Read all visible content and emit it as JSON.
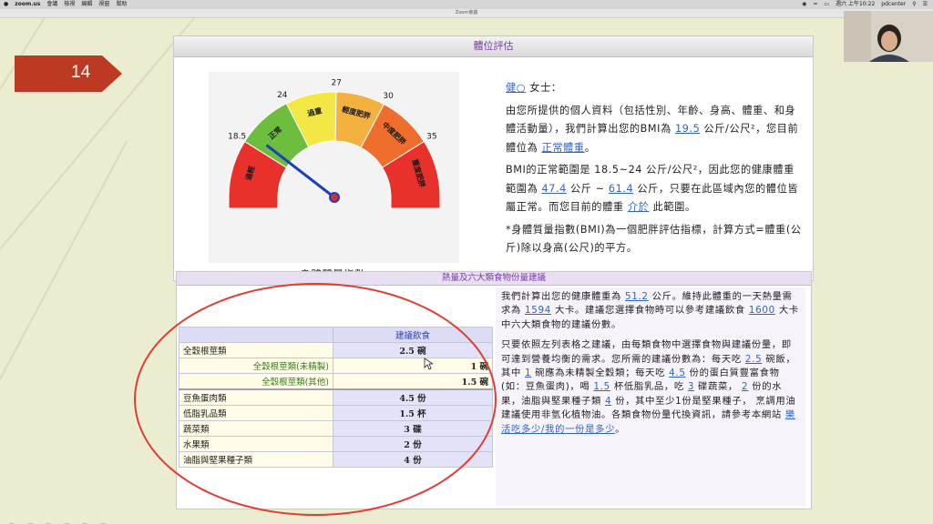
{
  "menubar": {
    "app": "zoom.us",
    "menus": [
      "會議",
      "檢視",
      "編輯",
      "視窗",
      "幫助"
    ],
    "clock": "週六 上午10:22",
    "user": "pdcenter"
  },
  "window_title": "Zoom會議",
  "slide": {
    "number": "14"
  },
  "panel1": {
    "title": "體位評估",
    "gauge": {
      "caption": "身體質量指數",
      "scale_labels": [
        "18.5",
        "24",
        "27",
        "30",
        "35"
      ],
      "zone_labels": [
        "過輕",
        "正常",
        "過重",
        "輕度肥胖",
        "中度肥胖",
        "重度肥胖"
      ],
      "zone_colors": [
        "#e8312b",
        "#6dbd3e",
        "#f3e745",
        "#f3b13f",
        "#ef6e2e",
        "#e8312b"
      ],
      "value": 19.5
    },
    "greeting_link": "健○",
    "greeting_rest": " 女士：",
    "p1_a": "由您所提供的個人資料（包括性別、年齡、身高、體重、和身體活動量），我們計算出您的BMI為 ",
    "bmi": "19.5",
    "p1_b": " 公斤/公尺²，您目前體位為 ",
    "status": "正常體重",
    "p1_c": "。",
    "p2_a": "BMI的正常範圍是 18.5~24 公斤/公尺²，因此您的健康體重範圍為 ",
    "weight_min": "47.4",
    "p2_b": " 公斤 ~ ",
    "weight_max": "61.4",
    "p2_c": " 公斤，只要在此區域內您的體位皆屬正常。而您目前的體重 ",
    "range_word": "介於",
    "p2_d": " 此範圍。",
    "p3": "*身體質量指數(BMI)為一個肥胖評估指標，計算方式=體重(公斤)除以身高(公尺)的平方。"
  },
  "panel2": {
    "title": "熱量及六大類食物份量建議",
    "table": {
      "header": "建議飲食",
      "rows": [
        {
          "name": "全穀根莖類",
          "value": "2.5 碗",
          "kind": "main"
        },
        {
          "name": "全穀根莖類(未精製)",
          "value": "1 碗",
          "kind": "sub"
        },
        {
          "name": "全穀根莖類(其他)",
          "value": "1.5 碗",
          "kind": "sub"
        },
        {
          "name": "豆魚蛋肉類",
          "value": "4.5 份",
          "kind": "main"
        },
        {
          "name": "低脂乳品類",
          "value": "1.5 杯",
          "kind": "main"
        },
        {
          "name": "蔬菜類",
          "value": "3 碟",
          "kind": "main"
        },
        {
          "name": "水果類",
          "value": "2 份",
          "kind": "main"
        },
        {
          "name": "油脂與堅果種子類",
          "value": "4 份",
          "kind": "main"
        }
      ]
    },
    "c1_a": "我們計算出您的健康體重為 ",
    "healthy_weight": "51.2",
    "c1_b": " 公斤。維持此體重的一天熱量需求為 ",
    "kcal_need": "1594",
    "c1_c": " 大卡。建議您選擇食物時可以參考建議飲食 ",
    "kcal_plan": "1600",
    "c1_d": " 大卡中六大類食物的建議份數。",
    "c2_a": "只要依照左列表格之建議，由每類食物中選擇食物與建議份量，即可達到營養均衡的需求。您所需的建議份數為：每天吃 ",
    "v_grain": "2.5",
    "c2_b": " 碗飯，其中 ",
    "v_unrefined": "1",
    "c2_c": " 碗應為未精製全穀類；每天吃 ",
    "v_protein": "4.5",
    "c2_d": " 份的蛋白質豐富食物(如：豆魚蛋肉)，喝 ",
    "v_dairy": "1.5",
    "c2_e": " 杯低脂乳品，吃 ",
    "v_veg": "3",
    "c2_f": " 碟蔬菜， ",
    "v_fruit": "2",
    "c2_g": " 份的水果，油脂與堅果種子類 ",
    "v_oil": "4",
    "c2_h": " 份，其中至少1份是堅果種子， 烹調用油建議使用非氫化植物油。各類食物份量代換資訊，請參考本網站 ",
    "site_link": "樂活吃多少/我的一份是多少",
    "c2_i": "。"
  }
}
